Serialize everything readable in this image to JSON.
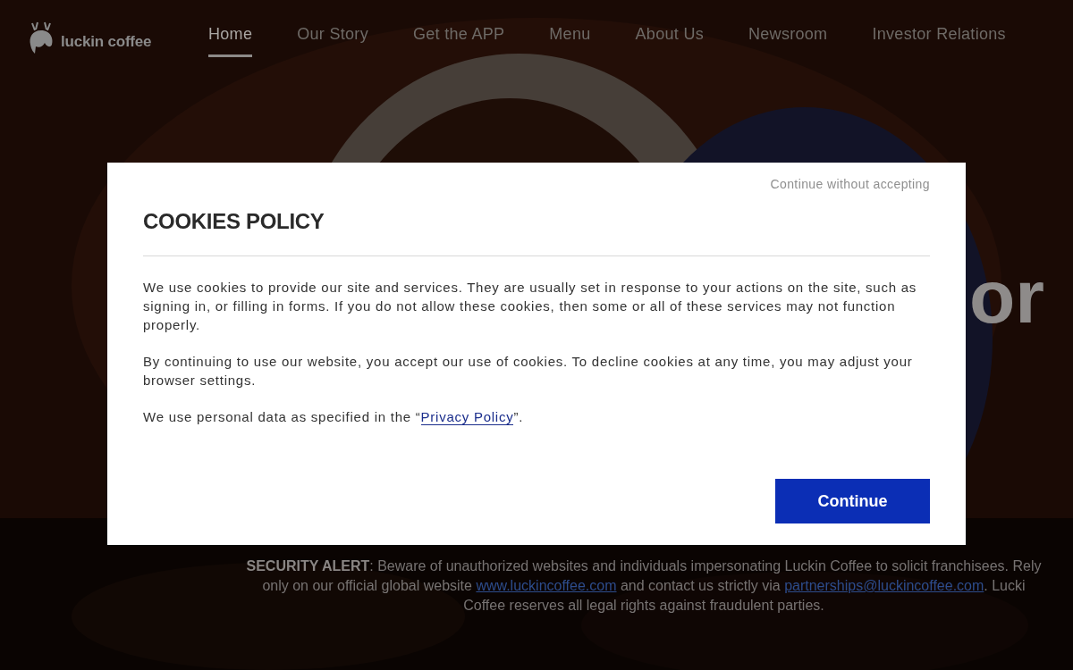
{
  "header": {
    "logo": "luckin coffee",
    "nav": [
      {
        "label": "Home",
        "selected": true
      },
      {
        "label": "Our Story",
        "selected": false
      },
      {
        "label": "Get the APP",
        "selected": false
      },
      {
        "label": "Menu",
        "selected": false
      },
      {
        "label": "About Us",
        "selected": false
      },
      {
        "label": "Newsroom",
        "selected": false
      },
      {
        "label": "Investor Relations",
        "selected": false
      }
    ]
  },
  "hero": {
    "heading_fragment": "or"
  },
  "security_alert": {
    "lines": [
      [
        {
          "kind": "text",
          "text": "**SECURITY ALERT**: Beware of unauthorized websites and individuals impersonating Luckin Coffee to solicit franchisees. Rely"
        }
      ],
      [
        {
          "kind": "text",
          "text": "only on our official global website "
        },
        {
          "kind": "link",
          "text": "www.luckincoffee.com"
        },
        {
          "kind": "text",
          "text": " and contact us strictly via "
        },
        {
          "kind": "link",
          "text": "partnerships@luckincoffee.com"
        },
        {
          "kind": "text",
          "text": ". Lucki"
        }
      ],
      [
        {
          "kind": "text",
          "text": "Coffee reserves all legal rights against fraudulent parties."
        }
      ]
    ]
  },
  "cookie_dialog": {
    "skip_link": "Continue without accepting",
    "title": "COOKIES POLICY",
    "paragraphs": [
      [
        {
          "kind": "text",
          "text": "We use cookies to provide our site and services. They are usually set in response to your actions on the site, such as signing in, or filling in forms. If you do not allow these cookies, then some or all of these services may not function properly."
        }
      ],
      [
        {
          "kind": "text",
          "text": "By continuing to use our website, you accept our use of cookies. To decline cookies at any time, you may adjust your browser settings."
        }
      ],
      [
        {
          "kind": "text",
          "text": "We use personal data as specified in the “"
        },
        {
          "kind": "link",
          "text": "Privacy Policy"
        },
        {
          "kind": "text",
          "text": "”."
        }
      ]
    ],
    "button": "Continue"
  }
}
